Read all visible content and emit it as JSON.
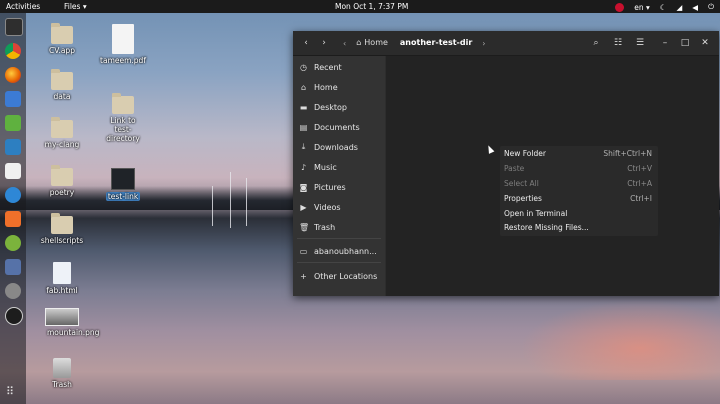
{
  "topbar": {
    "activities": "Activities",
    "app_menu": "Files",
    "app_menu_caret": "▾",
    "clock": "Mon Oct  1,  7:37 PM",
    "language": "en",
    "language_caret": "▾",
    "icons": [
      "debian-logo-icon",
      "night-mode-icon",
      "wifi-icon",
      "volume-icon",
      "power-icon"
    ]
  },
  "dock": {
    "icons": [
      "terminal-icon",
      "chrome-icon",
      "firefox-icon",
      "writer-icon",
      "libreoffice-icon",
      "virtualbox-icon",
      "gedit-icon",
      "discord-icon",
      "office-icon",
      "android-studio-icon",
      "tweaks-icon",
      "github-icon",
      "obs-icon",
      "show-apps-icon"
    ]
  },
  "desktop": {
    "items": [
      {
        "label": "CV.app",
        "kind": "folder"
      },
      {
        "label": "tameem.pdf",
        "kind": "pdf"
      },
      {
        "label": "data",
        "kind": "folder"
      },
      {
        "label": "Link to test-directory",
        "kind": "folder-link"
      },
      {
        "label": "my-clang",
        "kind": "folder"
      },
      {
        "label": "poetry",
        "kind": "folder"
      },
      {
        "label": "test-link",
        "kind": "link",
        "selected": true
      },
      {
        "label": "shellscripts",
        "kind": "folder"
      },
      {
        "label": "fab.html",
        "kind": "html"
      },
      {
        "label": "mountain.png",
        "kind": "image"
      },
      {
        "label": "Trash",
        "kind": "trash"
      }
    ]
  },
  "window": {
    "path": {
      "home": "Home",
      "current": "another-test-dir"
    },
    "sidebar": [
      {
        "label": "Recent",
        "icon": "clock-icon"
      },
      {
        "label": "Home",
        "icon": "home-icon"
      },
      {
        "label": "Desktop",
        "icon": "folder-icon"
      },
      {
        "label": "Documents",
        "icon": "document-icon"
      },
      {
        "label": "Downloads",
        "icon": "download-icon"
      },
      {
        "label": "Music",
        "icon": "music-icon"
      },
      {
        "label": "Pictures",
        "icon": "camera-icon"
      },
      {
        "label": "Videos",
        "icon": "video-icon"
      },
      {
        "label": "Trash",
        "icon": "trash-icon"
      },
      {
        "label": "abanoubhann...",
        "icon": "drive-icon"
      },
      {
        "label": "Other Locations",
        "icon": "plus-icon"
      }
    ]
  },
  "context_menu": [
    {
      "label": "New Folder",
      "shortcut": "Shift+Ctrl+N",
      "enabled": true
    },
    {
      "label": "Paste",
      "shortcut": "Ctrl+V",
      "enabled": false
    },
    {
      "label": "Select All",
      "shortcut": "Ctrl+A",
      "enabled": false
    },
    {
      "label": "Properties",
      "shortcut": "Ctrl+I",
      "enabled": true
    },
    {
      "label": "Open in Terminal",
      "shortcut": "",
      "enabled": true
    },
    {
      "label": "Restore Missing Files...",
      "shortcut": "",
      "enabled": true
    }
  ]
}
